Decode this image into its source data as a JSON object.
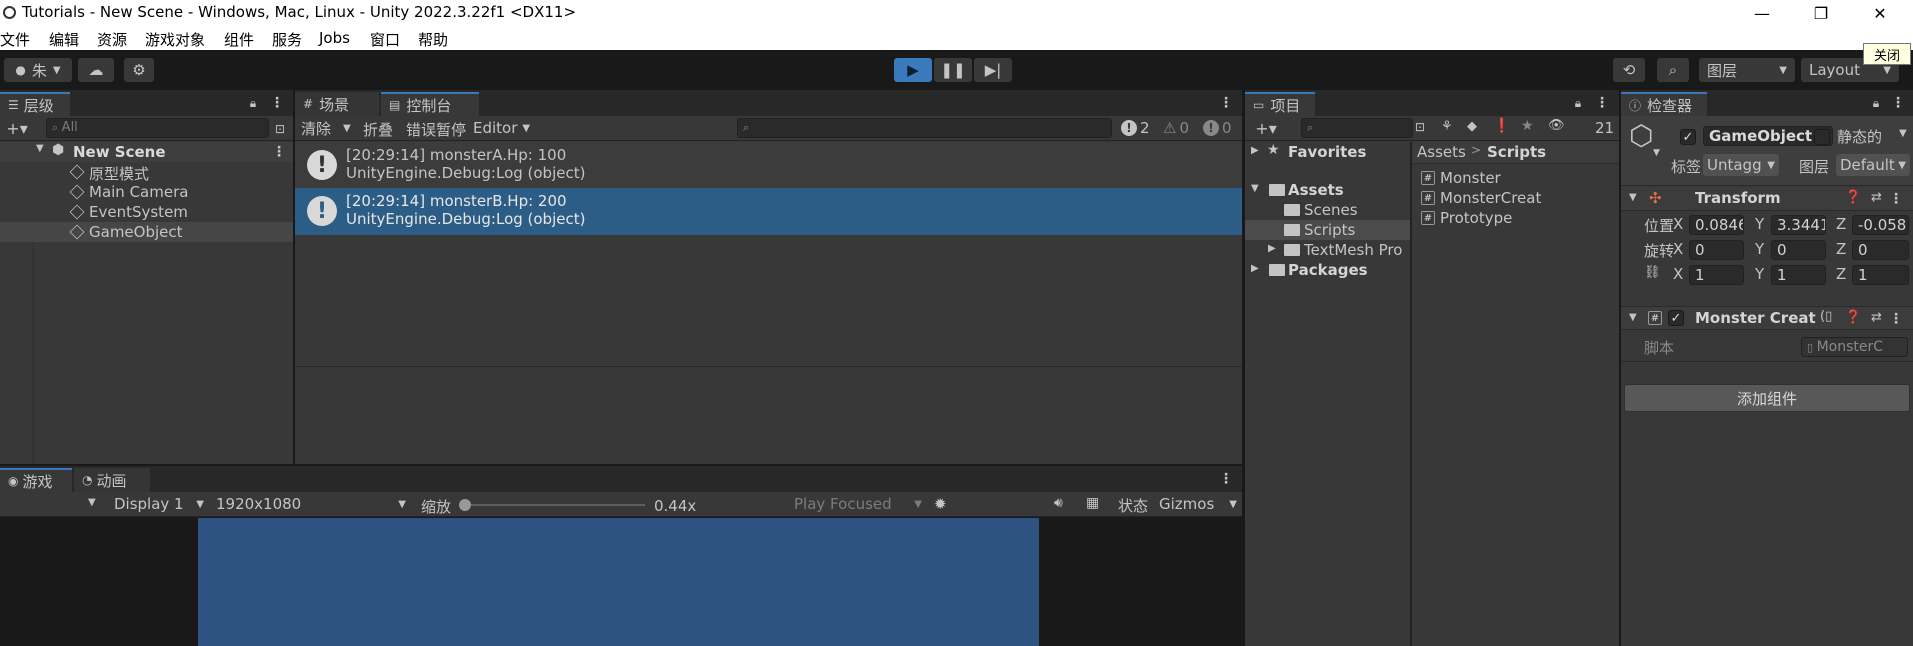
{
  "window": {
    "title": "Tutorials - New Scene - Windows, Mac, Linux - Unity 2022.3.22f1 <DX11>"
  },
  "menu": [
    "文件",
    "编辑",
    "资源",
    "游戏对象",
    "组件",
    "服务",
    "Jobs",
    "窗口",
    "帮助"
  ],
  "tooltip": "关闭",
  "toolbar": {
    "account": "朱",
    "layers": "图层",
    "layout": "Layout"
  },
  "hierarchy": {
    "tab": "层级",
    "search_placeholder": "All",
    "scene": "New Scene",
    "items": [
      "原型模式",
      "Main Camera",
      "EventSystem",
      "GameObject"
    ]
  },
  "console": {
    "tabs": [
      "场景",
      "控制台"
    ],
    "clear": "清除",
    "collapse": "折叠",
    "error_pause": "错误暂停",
    "editor": "Editor",
    "counts": {
      "log": "2",
      "warn": "0",
      "error": "0"
    },
    "logs": [
      {
        "line1": "[20:29:14] monsterA.Hp: 100",
        "line2": "UnityEngine.Debug:Log (object)"
      },
      {
        "line1": "[20:29:14] monsterB.Hp: 200",
        "line2": "UnityEngine.Debug:Log (object)"
      }
    ]
  },
  "game": {
    "tabs": [
      "游戏",
      "动画"
    ],
    "display": "Display 1",
    "resolution": "1920x1080",
    "scale_label": "缩放",
    "scale_value": "0.44x",
    "scale_fraction": 0.0,
    "play_focused": "Play Focused",
    "status": "状态",
    "gizmos": "Gizmos",
    "viewport_color": "#2e5281"
  },
  "project": {
    "tab": "项目",
    "hidden_count": "21",
    "favorites": "Favorites",
    "assets": "Assets",
    "folders": [
      "Scenes",
      "Scripts",
      "TextMesh Pro"
    ],
    "packages": "Packages",
    "breadcrumb": [
      "Assets",
      "Scripts"
    ],
    "files": [
      "Monster",
      "MonsterCreat",
      "Prototype"
    ]
  },
  "inspector": {
    "tab": "检查器",
    "object_name": "GameObject",
    "static_label": "静态的",
    "tag_label": "标签",
    "tag_value": "Untagg",
    "layer_label": "图层",
    "layer_value": "Default",
    "transform": {
      "title": "Transform",
      "rows": [
        {
          "label": "位置",
          "x": "0.0846",
          "y": "3.3441",
          "z": "-0.058"
        },
        {
          "label": "旋转",
          "x": "0",
          "y": "0",
          "z": "0"
        },
        {
          "label": "",
          "x": "1",
          "y": "1",
          "z": "1"
        }
      ]
    },
    "component": {
      "title": "Monster Creat",
      "script_label": "脚本",
      "script_value": "MonsterC"
    },
    "add_component": "添加组件"
  },
  "colors": {
    "accent": "#3a79bb",
    "selection": "#2c5d87",
    "panel": "#383838"
  }
}
